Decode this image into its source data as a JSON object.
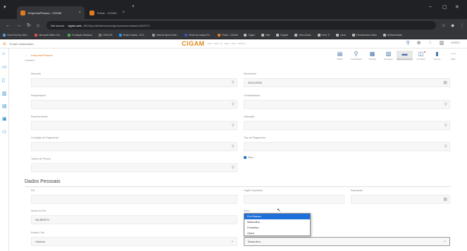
{
  "browser": {
    "tabs": [
      {
        "title": "Empresa/Pessoa - CIGAM",
        "color": "#e07b24"
      },
      {
        "title": "Entrar - CIGAM",
        "color": "#e07b24"
      }
    ],
    "url_warning": "Not secure",
    "url_host": "cigam-web",
    "url_path": ":8520/portal/elaborados/ges/pessoa/cadastro/ADSTO",
    "bookmarks": [
      "Cloud Tool my Wra...",
      "Microsoft Office Onl...",
      "Fundação Estadual",
      "CGM IDE",
      "Radio Gazeta - 91.9...",
      "Internet Speed Test...",
      "Portal da Justiça Fe...",
      "Portal - CIGAM",
      "Cigam",
      "Vale",
      "English",
      "Video Aulas",
      "Drive TI",
      "Casa",
      "Ferramentas Online",
      "All Bookmarks"
    ]
  },
  "app": {
    "menu_title": "Portal Colaborativo",
    "logo": "CIGAM",
    "logo_subtitle": "ERP · CRM · BI · WMS · MES · MOBILE",
    "user": "HNPEG"
  },
  "page": {
    "breadcrumb": "Empresa/Pessoa",
    "subtitle": "Cadastro"
  },
  "toolbar": [
    {
      "label": "Salvar",
      "icon": "save-icon",
      "glyph": "▤"
    },
    {
      "label": "Localização",
      "icon": "location-icon",
      "glyph": "⚲"
    },
    {
      "label": "Vending",
      "icon": "vending-icon",
      "glyph": "▦"
    },
    {
      "label": "Entregas",
      "icon": "deliveries-icon",
      "glyph": "▧"
    },
    {
      "label": "Mapa Estatístico",
      "icon": "chart-icon",
      "glyph": "▬"
    },
    {
      "label": "Contatos",
      "icon": "contacts-icon",
      "glyph": "◫"
    },
    {
      "label": "Anexos",
      "icon": "attachments-icon",
      "glyph": "▮"
    },
    {
      "label": "Mais",
      "icon": "more-icon",
      "glyph": "⋯"
    }
  ],
  "form": {
    "mercado_label": "Mercado",
    "aniversario_label": "Aniversário",
    "aniversario_value": "29/11/2006",
    "responsavel_label": "Responsável",
    "centralizadora_label": "Centralizadora",
    "representante_label": "Representante",
    "indicacao_label": "Indicação",
    "condicao_label": "Condição de Pagamento",
    "tipo_pagamento_label": "Tipo de Pagamento",
    "tabela_label": "Tabela de Preços",
    "ativo_label": "Ativo",
    "section_title": "Dados Pessoais",
    "rg_label": "RG",
    "orgao_label": "Orgão Expedidor",
    "expedicao_label": "Expedição",
    "nome_pai_label": "Nome do Pai",
    "nome_pai_value": "GILBERTO",
    "sexo_label": "Sexo",
    "estado_civil_label": "Estado Civil",
    "estado_civil_value": "Casado",
    "sexo_value": "Masculino"
  },
  "dropdown": {
    "options": [
      "Em Branco",
      "Masculino",
      "Feminino",
      "Outro"
    ],
    "highlighted": "Em Branco"
  }
}
